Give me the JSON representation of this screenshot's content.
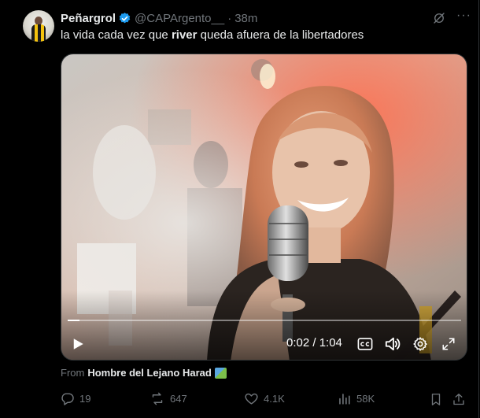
{
  "tweet": {
    "display_name": "Peñargrol",
    "handle": "@CAPArgento__",
    "separator": "·",
    "time_ago": "38m",
    "text_before": "la vida cada vez que ",
    "text_bold": "river",
    "text_after": " queda afuera de la libertadores",
    "more_label": "···"
  },
  "video": {
    "time_display": "0:02 / 1:04",
    "progress": 0.03
  },
  "attribution": {
    "from_label": "From",
    "source_name": "Hombre del Lejano Harad"
  },
  "actions": {
    "replies": "19",
    "reposts": "647",
    "likes": "4.1K",
    "views": "58K"
  },
  "colors": {
    "background": "#000000",
    "text_primary": "#e7e9ea",
    "text_muted": "#71767b",
    "verified_blue": "#1d9bf0",
    "divider": "#2f3336"
  }
}
